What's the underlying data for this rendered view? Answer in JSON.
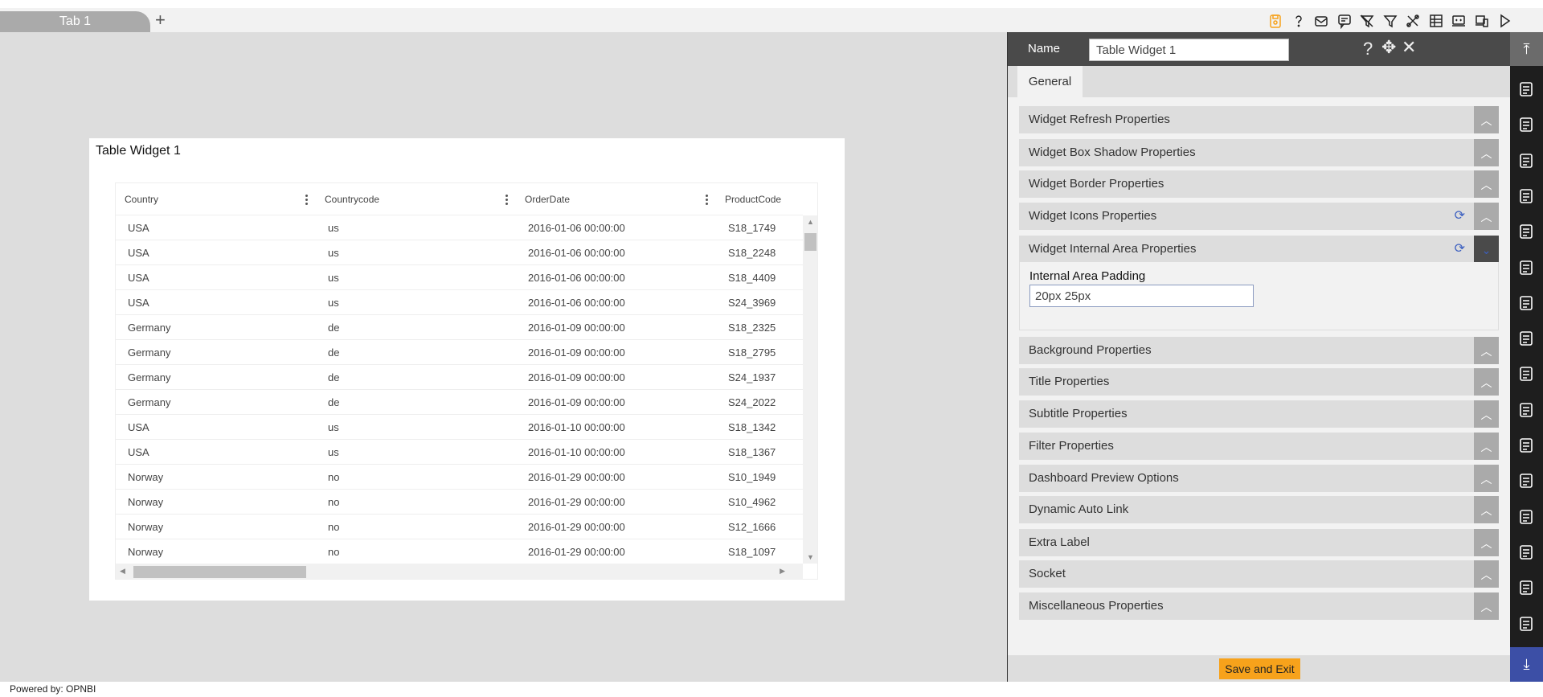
{
  "tabs": [
    {
      "label": "Tab 1"
    }
  ],
  "add_tab_label": "+",
  "toolbar": {
    "icons": [
      "save-icon",
      "help-icon",
      "mail-icon",
      "comment-icon",
      "clear-filter-icon",
      "filter-icon",
      "tools-icon",
      "table-icon",
      "embed-icon",
      "devices-icon",
      "play-icon"
    ],
    "save_color": "#f7a21b"
  },
  "widget": {
    "title": "Table Widget 1",
    "columns": [
      "Country",
      "Countrycode",
      "OrderDate",
      "ProductCode"
    ],
    "rows": [
      [
        "USA",
        "us",
        "2016-01-06 00:00:00",
        "S18_1749"
      ],
      [
        "USA",
        "us",
        "2016-01-06 00:00:00",
        "S18_2248"
      ],
      [
        "USA",
        "us",
        "2016-01-06 00:00:00",
        "S18_4409"
      ],
      [
        "USA",
        "us",
        "2016-01-06 00:00:00",
        "S24_3969"
      ],
      [
        "Germany",
        "de",
        "2016-01-09 00:00:00",
        "S18_2325"
      ],
      [
        "Germany",
        "de",
        "2016-01-09 00:00:00",
        "S18_2795"
      ],
      [
        "Germany",
        "de",
        "2016-01-09 00:00:00",
        "S24_1937"
      ],
      [
        "Germany",
        "de",
        "2016-01-09 00:00:00",
        "S24_2022"
      ],
      [
        "USA",
        "us",
        "2016-01-10 00:00:00",
        "S18_1342"
      ],
      [
        "USA",
        "us",
        "2016-01-10 00:00:00",
        "S18_1367"
      ],
      [
        "Norway",
        "no",
        "2016-01-29 00:00:00",
        "S10_1949"
      ],
      [
        "Norway",
        "no",
        "2016-01-29 00:00:00",
        "S10_4962"
      ],
      [
        "Norway",
        "no",
        "2016-01-29 00:00:00",
        "S12_1666"
      ],
      [
        "Norway",
        "no",
        "2016-01-29 00:00:00",
        "S18_1097"
      ]
    ]
  },
  "panel": {
    "name_label": "Name",
    "name_value": "Table Widget 1",
    "tab_general": "General",
    "sections": [
      {
        "label": "Widget Refresh Properties"
      },
      {
        "label": "Widget Box Shadow Properties"
      },
      {
        "label": "Widget Border Properties"
      },
      {
        "label": "Widget Icons Properties",
        "refresh": true
      },
      {
        "label": "Widget Internal Area Properties",
        "refresh": true,
        "expanded": true
      },
      {
        "label": "Background Properties"
      },
      {
        "label": "Title Properties"
      },
      {
        "label": "Subtitle Properties"
      },
      {
        "label": "Filter Properties"
      },
      {
        "label": "Dashboard Preview Options"
      },
      {
        "label": "Dynamic Auto Link"
      },
      {
        "label": "Extra Label"
      },
      {
        "label": "Socket"
      },
      {
        "label": "Miscellaneous Properties"
      }
    ],
    "padding_label": "Internal Area Padding",
    "padding_value": "20px 25px",
    "save_label": "Save and Exit",
    "save_color": "#f7a21b"
  },
  "right_bar": {
    "icons": [
      "table-widget-icon",
      "line-chart-icon",
      "map-icon",
      "report-icon",
      "document-icon",
      "braces-icon",
      "image-icon",
      "pivot-icon",
      "calculator-doc-icon",
      "tree-icon",
      "bar-chart-icon",
      "copy-icon",
      "cubes-icon",
      "rx-icon",
      "save-doc-icon",
      "layers-icon"
    ],
    "bottom_color": "#3c4fa6"
  },
  "footer": {
    "text": "Powered by: OPNBI"
  }
}
